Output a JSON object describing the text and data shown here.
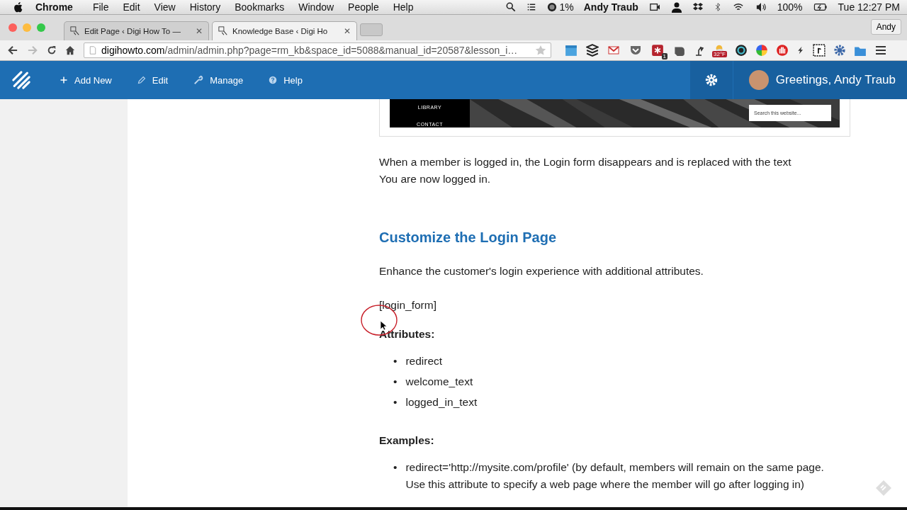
{
  "menu_bar": {
    "app": "Chrome",
    "items": [
      "File",
      "Edit",
      "View",
      "History",
      "Bookmarks",
      "Window",
      "People",
      "Help"
    ],
    "status": {
      "cpu": "1%",
      "user": "Andy Traub",
      "battery": "100%",
      "clock": "Tue 12:27 PM"
    }
  },
  "tabs": [
    {
      "title": "Edit Page ‹ Digi How To —",
      "close": "✕",
      "selected": false
    },
    {
      "title": "Knowledge Base ‹ Digi Ho",
      "close": "✕",
      "selected": true
    }
  ],
  "profile": "Andy",
  "address_bar": {
    "url_host": "digihowto.com",
    "url_path": "/admin/admin.php?page=rm_kb&space_id=5088&manual_id=20587&lesson_i…"
  },
  "extensions": {
    "badge_count": "1",
    "weather": "32°F"
  },
  "admin_bar": {
    "items": [
      {
        "kind": "add",
        "label": "Add New"
      },
      {
        "kind": "edit",
        "label": "Edit"
      },
      {
        "kind": "manage",
        "label": "Manage"
      },
      {
        "kind": "help",
        "label": "Help"
      }
    ],
    "greeting": "Greetings, Andy Traub"
  },
  "embedded_image": {
    "nav": [
      "LIBRARY",
      "CONTACT"
    ],
    "search_placeholder": "Search this website..."
  },
  "content": [
    {
      "kind": "paragraph",
      "text": "When a member is logged in, the Login form disappears and is replaced with the text You are now logged in."
    },
    {
      "kind": "heading",
      "text": "Customize the Login Page"
    },
    {
      "kind": "paragraph",
      "text": "Enhance the customer's login experience with additional attributes."
    },
    {
      "kind": "paragraph",
      "text": "[login_form]"
    },
    {
      "kind": "label",
      "text": "Attributes:"
    },
    {
      "kind": "list",
      "bullet": "•",
      "items": [
        "redirect",
        "welcome_text",
        "logged_in_text"
      ]
    },
    {
      "kind": "label",
      "text": "Examples:"
    },
    {
      "kind": "list",
      "bullet": "•",
      "items": [
        "redirect='http://mysite.com/profile' (by default, members will remain on the same page. Use this attribute to specify a web page where the member will go after logging in)"
      ]
    }
  ]
}
